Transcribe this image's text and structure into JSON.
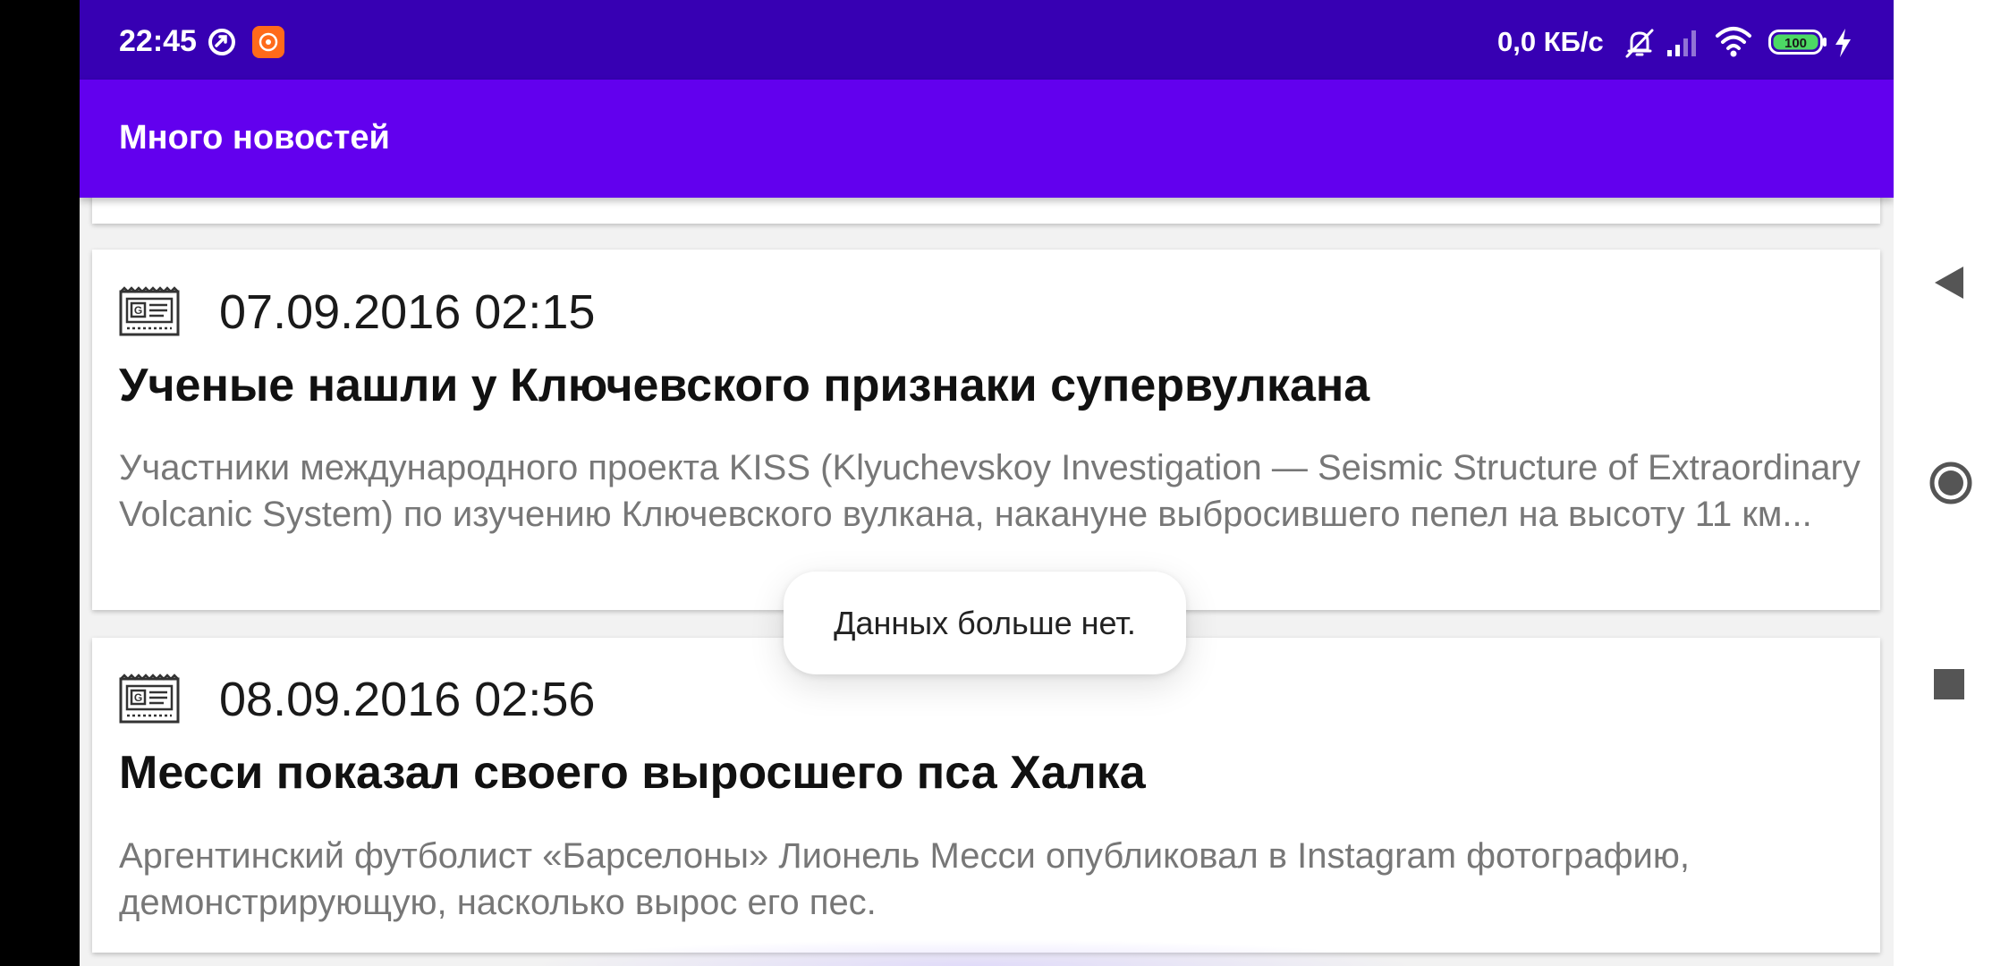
{
  "status_bar": {
    "time": "22:45",
    "speed": "0,0 КБ/с",
    "battery": "100",
    "icons": [
      "sync-icon",
      "screen-recorder-icon",
      "bell-off-icon",
      "signal-icon",
      "wifi-icon",
      "battery-icon",
      "charging-icon"
    ]
  },
  "app_bar": {
    "title": "Много новостей"
  },
  "news": [
    {
      "date": "07.09.2016 02:15",
      "title": "Ученые нашли у Ключевского признаки супервулкана",
      "description": "Участники международного проекта KISS (Klyuchevskoy Investigation — Seismic Structure of Extraordinary Volcanic System) по изучению Ключевского вулкана, накануне выбросившего пепел на высоту 11 км..."
    },
    {
      "date": "08.09.2016 02:56",
      "title": "Месси показал своего выросшего пса Халка",
      "description": "Аргентинский футболист «Барселоны» Лионель Месси опубликовал в Instagram фотографию, демонстрирующую, насколько вырос его пес."
    }
  ],
  "toast": {
    "text": "Данных больше нет."
  },
  "nav_bar": {
    "icons": [
      "back-icon",
      "home-icon",
      "recents-icon"
    ]
  },
  "colors": {
    "status_bar": "#3700b3",
    "app_bar": "#6200ee",
    "background": "#f2f2f2",
    "card": "#ffffff",
    "title_text": "#111111",
    "desc_text": "#777777"
  }
}
